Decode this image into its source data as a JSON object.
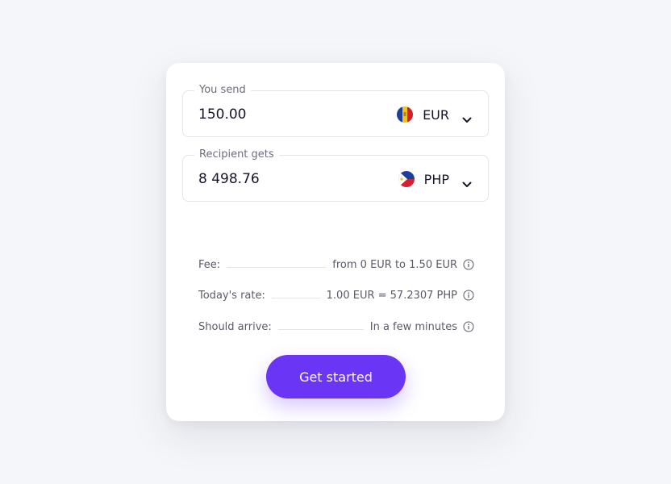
{
  "send": {
    "label": "You send",
    "amount": "150.00",
    "currency": "EUR",
    "flag_icon": "andorra-flag-icon"
  },
  "recipient": {
    "label": "Recipient gets",
    "amount": "8 498.76",
    "currency": "PHP",
    "flag_icon": "philippines-flag-icon"
  },
  "details": [
    {
      "label": "Fee:",
      "value": "from 0 EUR to 1.50 EUR"
    },
    {
      "label": "Today's rate:",
      "value": "1.00 EUR = 57.2307 PHP"
    },
    {
      "label": "Should arrive:",
      "value": "In a few minutes"
    }
  ],
  "cta": {
    "label": "Get started"
  },
  "colors": {
    "accent": "#6a35f5",
    "background": "#f5f6f9",
    "card": "#ffffff"
  }
}
